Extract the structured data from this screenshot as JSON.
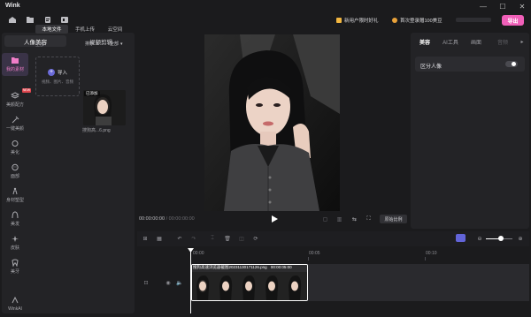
{
  "app": {
    "title": "Wink",
    "promo_new_user": "新用户限时好礼",
    "promo_first_login": "首次登录赠100美豆",
    "brand_pink": "#f05fb8",
    "export_label": "导出"
  },
  "toolbar_icons": [
    "home-icon",
    "folder-icon",
    "clipboard-icon",
    "pr-icon"
  ],
  "window_controls": [
    "—",
    "☐",
    "✕"
  ],
  "left_panel": {
    "tabs": [
      "人像美容",
      "视频剪辑"
    ],
    "active_tab": "人像美容",
    "rail": [
      {
        "label": "我的素材",
        "icon": "folder-icon",
        "active": true
      },
      {
        "label": "美颜配方",
        "icon": "layers-icon",
        "active": false
      },
      {
        "label": "一键美颜",
        "icon": "wand-icon",
        "active": false
      },
      {
        "label": "美化",
        "icon": "sparkle-icon",
        "active": false
      },
      {
        "label": "面部",
        "icon": "face-icon",
        "active": false
      },
      {
        "label": "身材塑型",
        "icon": "body-icon",
        "active": false
      },
      {
        "label": "美发",
        "icon": "hair-icon",
        "active": false
      },
      {
        "label": "皮肤",
        "icon": "skin-icon",
        "active": false
      },
      {
        "label": "美牙",
        "icon": "tooth-icon",
        "active": false
      },
      {
        "label": "WinkAI",
        "icon": "ai-icon",
        "active": false
      }
    ],
    "sub_tabs": [
      "本地文件",
      "手机上传",
      "云空间"
    ],
    "active_sub_tab": "本地文件",
    "all_label": "全部",
    "sort_label": "排序",
    "filter_label": "全部",
    "import": {
      "label": "导入",
      "hint": "视频、图片、音频"
    },
    "thumb": {
      "badge": "已添加",
      "name": "搜狗高...6.png"
    }
  },
  "preview": {
    "timecode_current": "00:00:00:00",
    "timecode_total": "/ 00:00:00:00",
    "reset_ratio_label": "原始比例"
  },
  "right_panel": {
    "tabs": [
      "美容",
      "AI工具",
      "画面",
      "音频"
    ],
    "active_tab": "美容",
    "split_portrait_label": "区分人像",
    "split_portrait_on": false
  },
  "timeline": {
    "ruler": [
      "00:00",
      "00:05",
      "00:10"
    ],
    "clip_title": "搜狗高速浏览器截图20231130171126.png",
    "clip_duration": "00:00:05:00"
  }
}
